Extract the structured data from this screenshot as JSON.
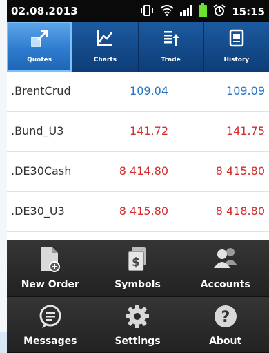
{
  "status": {
    "date": "02.08.2013",
    "time": "15:15"
  },
  "tabs": [
    {
      "label": "Quotes",
      "icon": "quotes-icon",
      "active": true
    },
    {
      "label": "Charts",
      "icon": "chart-icon"
    },
    {
      "label": "Trade",
      "icon": "trade-icon"
    },
    {
      "label": "History",
      "icon": "history-icon"
    }
  ],
  "quotes": [
    {
      "symbol": ".BrentCrud",
      "bid": "109.04",
      "ask": "109.09",
      "color": "#2673c4"
    },
    {
      "symbol": ".Bund_U3",
      "bid": "141.72",
      "ask": "141.75",
      "color": "#d62b2b"
    },
    {
      "symbol": ".DE30Cash",
      "bid": "8 414.80",
      "ask": "8 415.80",
      "color": "#d62b2b"
    },
    {
      "symbol": ".DE30_U3",
      "bid": "8 415.80",
      "ask": "8 418.80",
      "color": "#d62b2b"
    }
  ],
  "menu": [
    {
      "label": "New Order",
      "icon": "new-order-icon"
    },
    {
      "label": "Symbols",
      "icon": "symbols-icon"
    },
    {
      "label": "Accounts",
      "icon": "accounts-icon"
    },
    {
      "label": "Messages",
      "icon": "messages-icon"
    },
    {
      "label": "Settings",
      "icon": "settings-icon"
    },
    {
      "label": "About",
      "icon": "about-icon"
    }
  ]
}
